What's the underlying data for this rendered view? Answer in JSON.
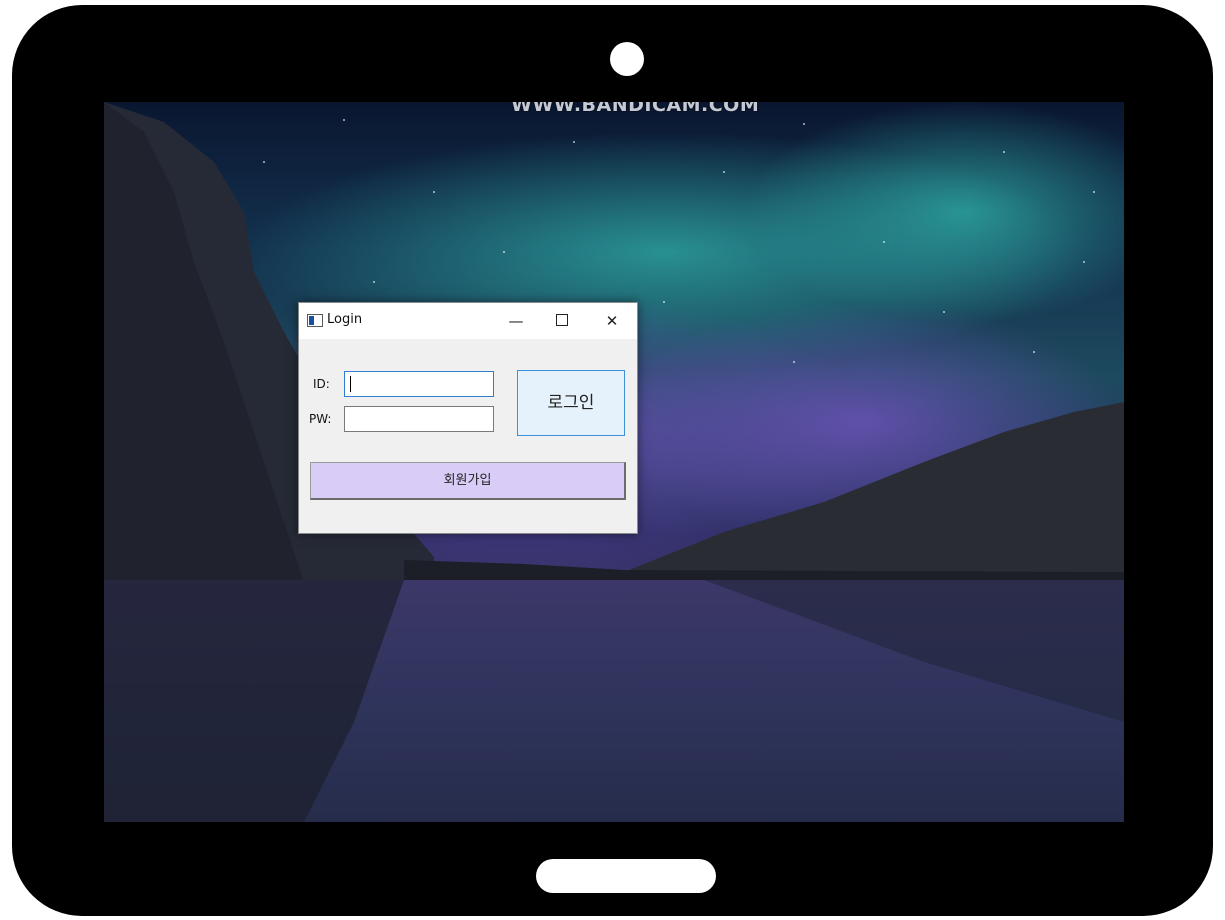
{
  "watermark": "WWW.BANDICAM.COM",
  "window": {
    "title": "Login",
    "minimize_glyph": "—",
    "close_glyph": "✕"
  },
  "form": {
    "id_label": "ID:",
    "pw_label": "PW:",
    "id_value": "",
    "pw_value": "",
    "login_label": "로그인",
    "signup_label": "회원가입"
  },
  "icons": {
    "app": "window-app-icon",
    "minimize": "minimize-icon",
    "maximize": "maximize-icon",
    "close": "close-icon"
  }
}
